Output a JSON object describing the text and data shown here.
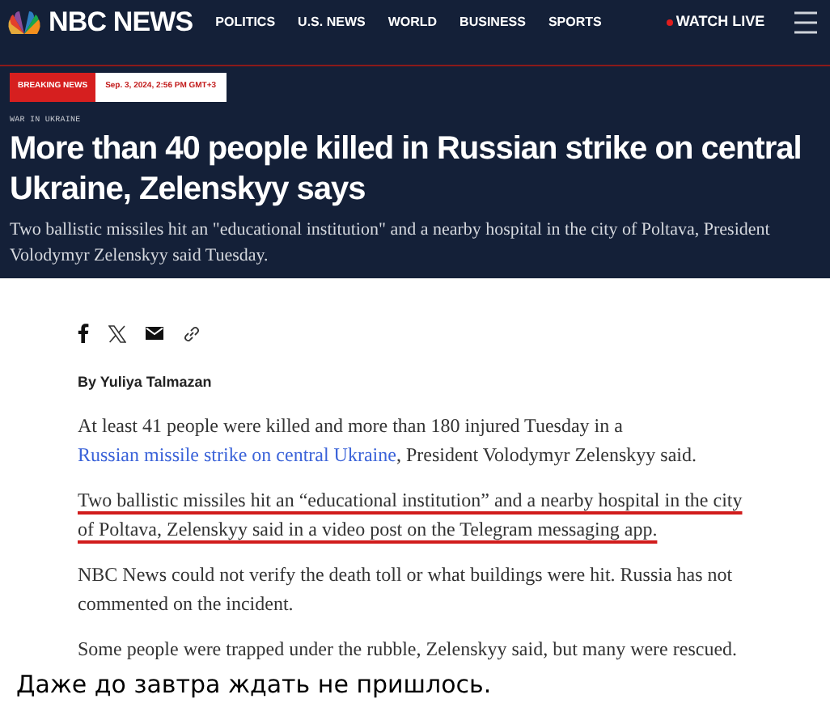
{
  "nav": {
    "logo": "NBC NEWS",
    "links": [
      "POLITICS",
      "U.S. NEWS",
      "WORLD",
      "BUSINESS",
      "SPORTS"
    ],
    "live": "WATCH LIVE"
  },
  "banner": {
    "label": "BREAKING NEWS",
    "timestamp": "Sep. 3, 2024, 2:56 PM GMT+3"
  },
  "article": {
    "kicker": "WAR IN UKRAINE",
    "headline": "More than 40 people killed in Russian strike on central Ukraine, Zelenskyy says",
    "dek": "Two ballistic missiles hit an \"educational institution\" and a nearby hospital in the city of Poltava, President Volodymyr Zelenskyy said Tuesday.",
    "byline": "By Yuliya Talmazan",
    "paragraphs": [
      {
        "underlined": false,
        "parts": [
          {
            "kind": "text",
            "text": "At least 41 people were killed and more than 180 injured Tuesday in a "
          },
          {
            "kind": "link",
            "text": "Russian missile strike on central Ukraine"
          },
          {
            "kind": "text",
            "text": ", President Volodymyr Zelenskyy said."
          }
        ]
      },
      {
        "underlined": true,
        "parts": [
          {
            "kind": "text",
            "text": "Two ballistic missiles hit an “educational institution” and a nearby hospital in the city of Poltava, Zelenskyy said in a video post on the Telegram messaging app."
          }
        ]
      },
      {
        "underlined": false,
        "parts": [
          {
            "kind": "text",
            "text": "NBC News could not verify the death toll or what buildings were hit. Russia has not commented on the incident."
          }
        ]
      },
      {
        "underlined": false,
        "parts": [
          {
            "kind": "text",
            "text": "Some people were trapped under the rubble, Zelenskyy said, but many were rescued."
          }
        ]
      }
    ]
  },
  "caption": "Даже до завтра ждать не пришлось."
}
